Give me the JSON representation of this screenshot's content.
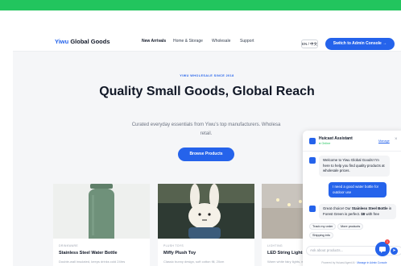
{
  "nav": {
    "brand_prefix": "Yiwu",
    "brand_suffix": "Global Goods",
    "links": [
      "New Arrivals",
      "Home & Storage",
      "Wholesale",
      "Support"
    ],
    "language": "EN / 中文",
    "admin_button": "Switch to Admin Console →"
  },
  "hero": {
    "label": "YIWU WHOLESALE SINCE 2018",
    "title": "Quality Small Goods, Global Reach",
    "subtitle": "Curated everyday essentials from Yiwu's top manufacturers. Wholesa",
    "subtitle_line2": "retail.",
    "browse_button": "Browse Products"
  },
  "products": [
    {
      "category": "DRINKWARE",
      "title": "Stainless Steel Water Bottle",
      "desc": "Double-wall insulated, keeps drinks cold 24hrs"
    },
    {
      "category": "PLUSH TOYS",
      "title": "Miffy Plush Toy",
      "desc": "Classic bunny design, soft cotton fill, 20cm"
    },
    {
      "category": "LIGHTING",
      "title": "LED String Lights (10m)",
      "desc": "Warm white fairy lights, waterproof"
    }
  ],
  "chat": {
    "name": "Huicast Assistant",
    "status": "● Online",
    "link": "Manage",
    "close": "×",
    "bot_msg_1": "Welcome to Yiwu Global Goods! I'm here to help you find quality products at wholesale prices.",
    "user_msg": "I need a good water bottle for outdoor use",
    "bot_msg_2_a": "Great choice! Our ",
    "bot_msg_2_bold": "Stainless Steel Bottle",
    "bot_msg_2_b": " in Forest Green is perfect. ",
    "bot_msg_2_price": "$8",
    "bot_msg_2_c": " with free",
    "quick_replies": [
      "Track my order",
      "More products",
      "Shipping info"
    ],
    "input_placeholder": "Ask about products...",
    "send": "➤",
    "footer_a": "Powered by Huicast Agent AI · ",
    "footer_link": "Manage in Admin Console"
  },
  "fab": {
    "badge": "1"
  },
  "colors": {
    "top_strip": "#22c55e",
    "accent": "#2563eb",
    "bottle": "#6f917a"
  },
  "icons": [
    "bot-icon",
    "chat-bubble-icon",
    "send-icon",
    "close-icon"
  ]
}
